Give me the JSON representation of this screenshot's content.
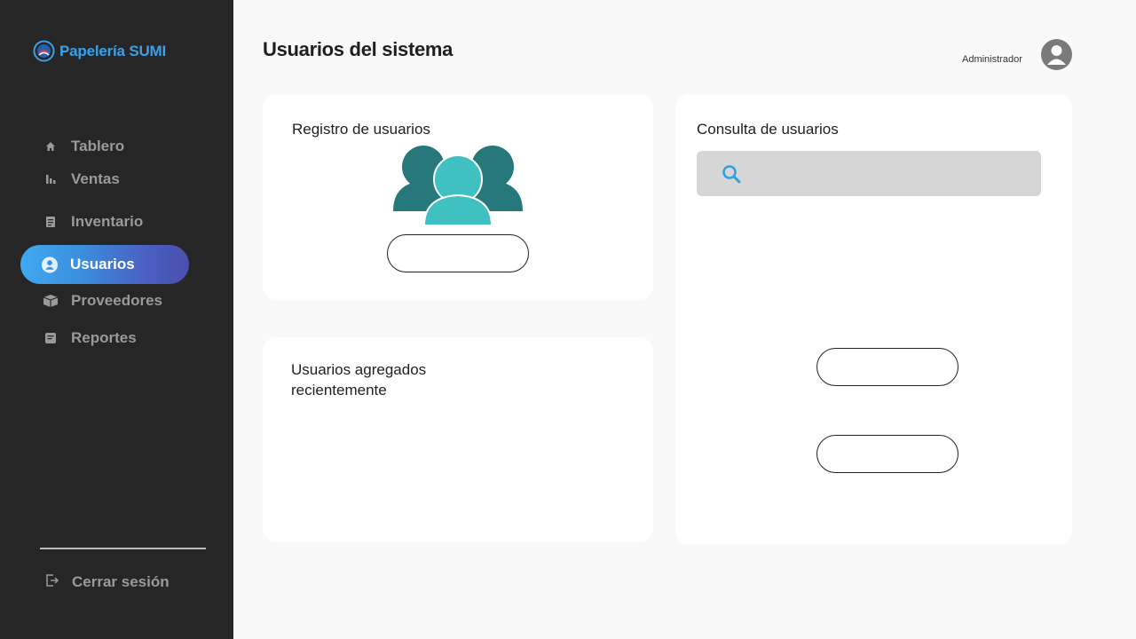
{
  "brand": {
    "name": "Papelería SUMI",
    "logo_icon": "circle-logo-icon",
    "color": "#3aa0e8"
  },
  "sidebar": {
    "items": [
      {
        "label": "Tablero",
        "icon": "home-icon",
        "active": false
      },
      {
        "label": "Ventas",
        "icon": "bar-chart-icon",
        "active": false
      },
      {
        "label": "Inventario",
        "icon": "clipboard-icon",
        "active": false
      },
      {
        "label": "Usuarios",
        "icon": "user-icon",
        "active": true
      },
      {
        "label": "Proveedores",
        "icon": "box-icon",
        "active": false
      },
      {
        "label": "Reportes",
        "icon": "report-icon",
        "active": false
      }
    ],
    "logout_label": "Cerrar sesión",
    "active_gradient": [
      "#3fa9f0",
      "#4a4fae"
    ]
  },
  "header": {
    "title": "Usuarios del sistema",
    "user_role": "Administrador"
  },
  "cards": {
    "registro": {
      "title": "Registro de usuarios",
      "button_label": ""
    },
    "recientes": {
      "title_line1": "Usuarios agregados",
      "title_line2": "recientemente"
    },
    "consulta": {
      "title": "Consulta de usuarios",
      "search_placeholder": "",
      "button1_label": "",
      "button2_label": ""
    }
  },
  "colors": {
    "sidebar_bg": "#262626",
    "users_dark": "#26787a",
    "users_light": "#40c0c0",
    "search_icon": "#2a9ee6"
  }
}
